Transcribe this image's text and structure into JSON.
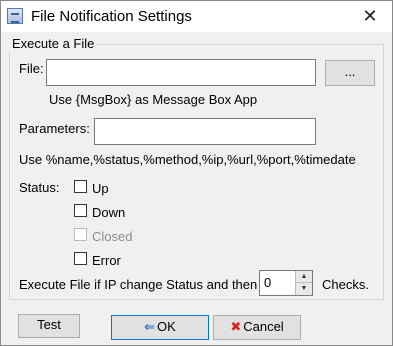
{
  "window": {
    "title": "File Notification Settings",
    "close_glyph": "✕"
  },
  "group": {
    "label": "Execute a File"
  },
  "file": {
    "label": "File:",
    "value": "",
    "browse_label": "...",
    "hint": "Use {MsgBox} as Message Box App"
  },
  "parameters": {
    "label": "Parameters:",
    "value": "",
    "hint": "Use %name,%status,%method,%ip,%url,%port,%timedate"
  },
  "status": {
    "label": "Status:",
    "options": [
      {
        "label": "Up",
        "checked": false,
        "enabled": true
      },
      {
        "label": "Down",
        "checked": false,
        "enabled": true
      },
      {
        "label": "Closed",
        "checked": false,
        "enabled": false
      },
      {
        "label": "Error",
        "checked": false,
        "enabled": true
      }
    ]
  },
  "ip_change": {
    "label_before": "Execute File if IP change Status and then",
    "value": "0",
    "label_after": "Checks."
  },
  "buttons": {
    "test": "Test",
    "ok": "OK",
    "cancel": "Cancel"
  },
  "icons": {
    "ok": "ok-arrow-icon",
    "cancel": "cancel-x-icon",
    "app": "app-icon"
  }
}
